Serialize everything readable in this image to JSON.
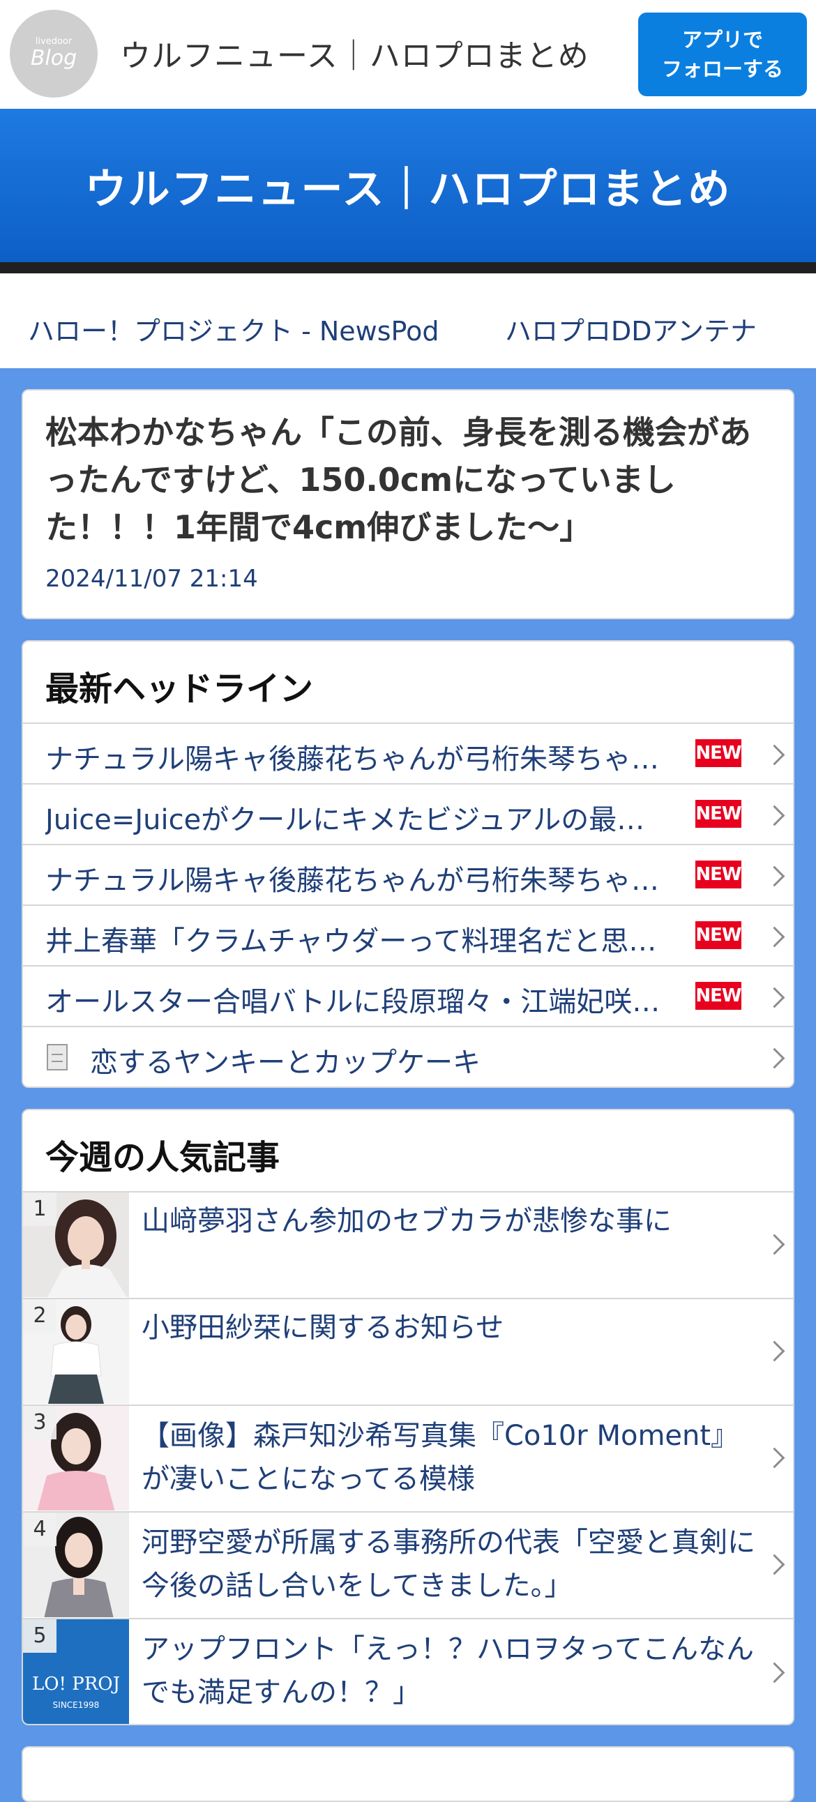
{
  "header": {
    "logo_small": "livedoor",
    "logo_main": "Blog",
    "site_name": "ウルフニュース｜ハロプロまとめ",
    "follow_line1": "アプリで",
    "follow_line2": "フォローする"
  },
  "hero": {
    "title": "ウルフニュース｜ハロプロまとめ"
  },
  "links": [
    "ハロー！プロジェクト - NewsPod",
    "ハロプロDDアンテナ"
  ],
  "article": {
    "title": "松本わかなちゃん「この前、身長を測る機会があったんですけど、150.0cmになっていました！！！1年間で4cm伸びました〜」",
    "date": "2024/11/07 21:14"
  },
  "headlines": {
    "heading": "最新ヘッドライン",
    "badge": "NEW",
    "items": [
      "ナチュラル陽キャ後藤花ちゃんが弓桁朱琴ちゃ…",
      "Juice=Juiceがクールにキメたビジュアルの最…",
      "ナチュラル陽キャ後藤花ちゃんが弓桁朱琴ちゃ…",
      "井上春華「クラムチャウダーって料理名だと思…",
      "オールスター合唱バトルに段原瑠々・江端妃咲…"
    ],
    "doc_item": "恋するヤンキーとカップケーキ"
  },
  "popular": {
    "heading": "今週の人気記事",
    "items": [
      {
        "rank": "1",
        "title": "山﨑夢羽さん参加のセブカラが悲惨な事に"
      },
      {
        "rank": "2",
        "title": "小野田紗栞に関するお知らせ"
      },
      {
        "rank": "3",
        "title": "【画像】森戸知沙希写真集『Co10r Moment』が凄いことになってる模様"
      },
      {
        "rank": "4",
        "title": "河野空愛が所属する事務所の代表「空愛と真剣に今後の話し合いをしてきました。」"
      },
      {
        "rank": "5",
        "title": "アップフロント「えっ！？ハロヲタってこんなんでも満足すんの！？」",
        "thumb_text": "LO! PROJ",
        "thumb_sub": "SINCE1998"
      }
    ]
  },
  "colors": {
    "page_bg": "#5b96e8",
    "accent": "#0a7fe0",
    "link_text": "#1f3f78",
    "new_badge": "#e8001f"
  }
}
